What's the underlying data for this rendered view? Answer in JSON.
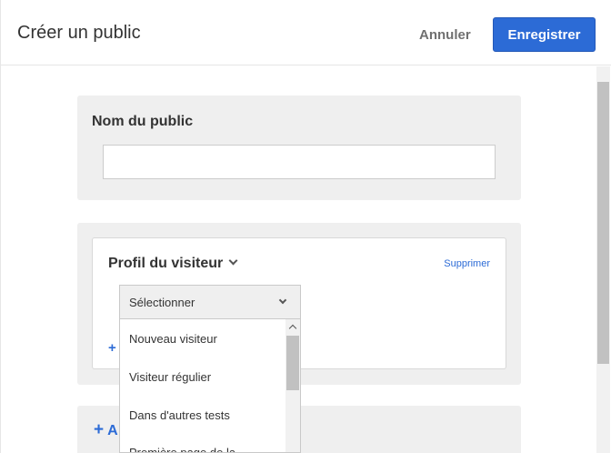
{
  "header": {
    "title": "Créer un public",
    "cancel_label": "Annuler",
    "save_label": "Enregistrer"
  },
  "name_panel": {
    "label": "Nom du public",
    "input_value": "",
    "input_placeholder": ""
  },
  "condition": {
    "title": "Profil du visiteur",
    "delete_label": "Supprimer",
    "select_value": "Sélectionner",
    "add_small": "+"
  },
  "dropdown": {
    "items": [
      "Nouveau visiteur",
      "Visiteur régulier",
      "Dans d'autres tests",
      "Première page de la"
    ]
  },
  "add_panel": {
    "plus": "+",
    "label": "A"
  },
  "colors": {
    "primary": "#2c6bd6",
    "panel_bg": "#efefef",
    "text": "#333333",
    "muted": "#707070"
  },
  "icons": {
    "title_chevron": "chevron-down-icon",
    "select_chevron": "chevron-down-icon",
    "add": "plus-icon"
  }
}
